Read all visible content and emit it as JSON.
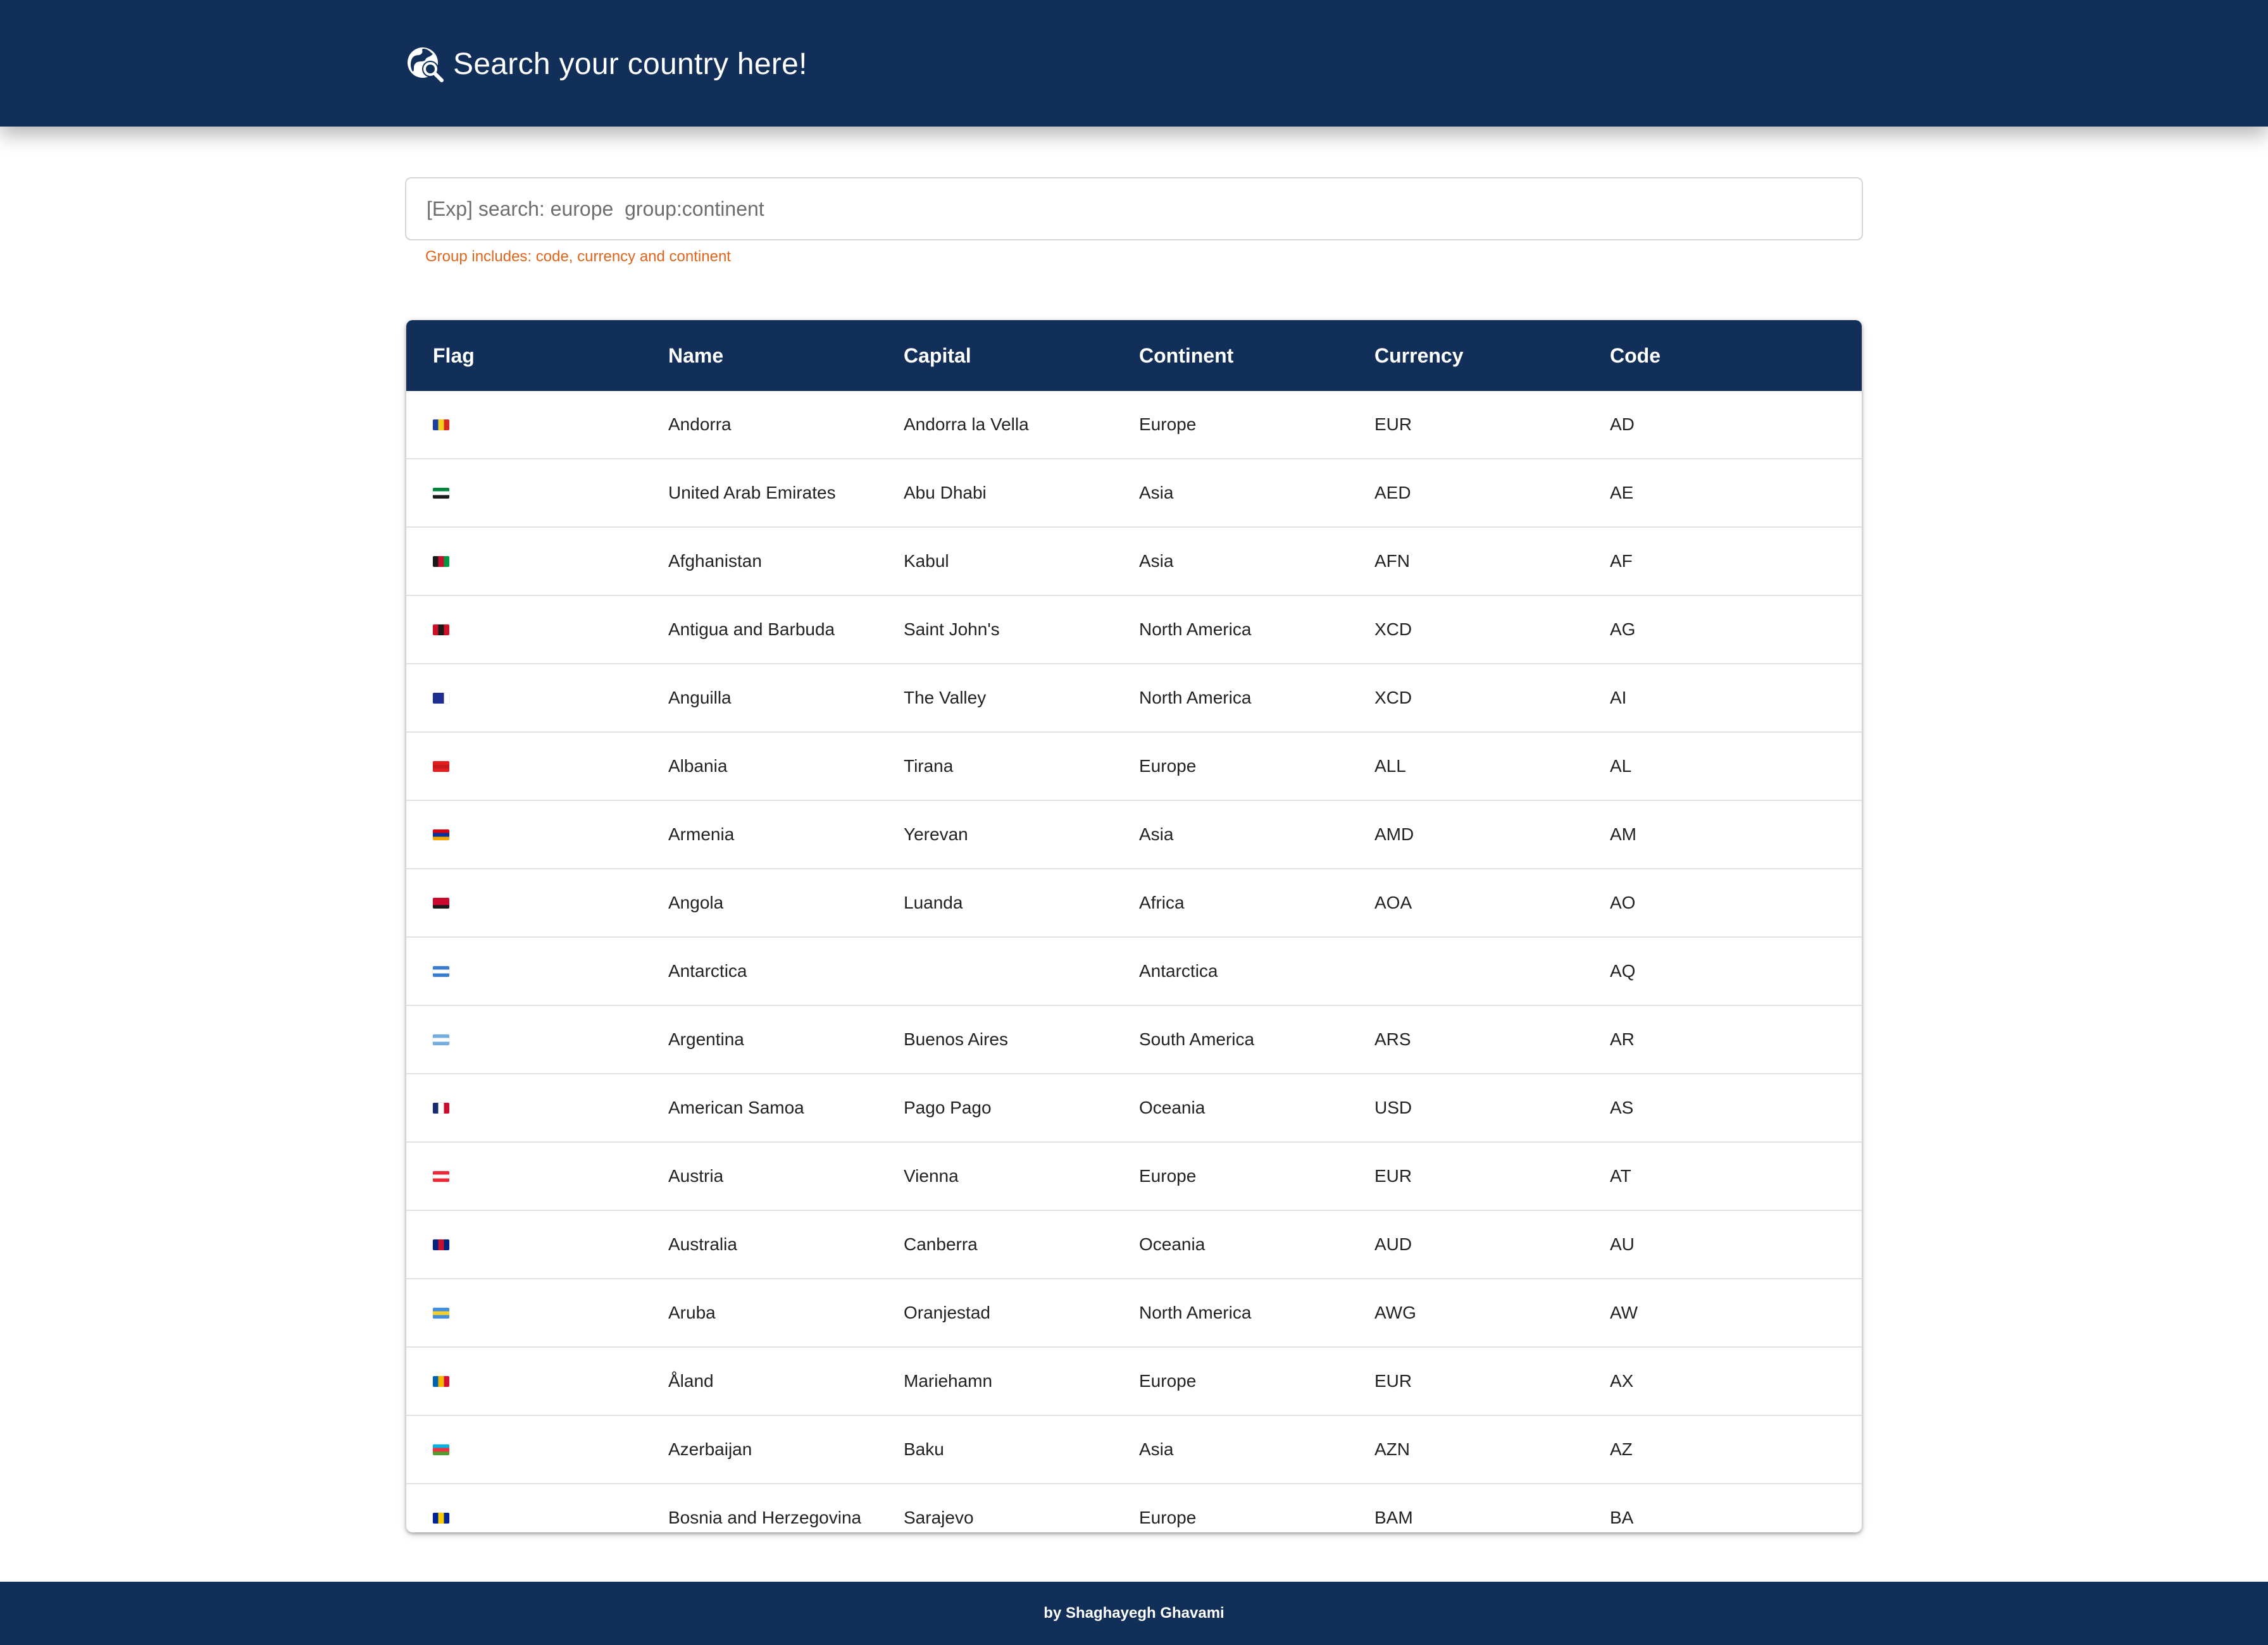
{
  "header": {
    "title": "Search your country here!",
    "icon": "globe-search-icon"
  },
  "search": {
    "placeholder": "[Exp] search: europe  group:continent",
    "value": "",
    "helper": "Group includes: code, currency and continent"
  },
  "table": {
    "columns": [
      "Flag",
      "Name",
      "Capital",
      "Continent",
      "Currency",
      "Code"
    ],
    "rows": [
      {
        "flag": "flag-ad-icon",
        "flag_colors": [
          "#1a3fa0",
          "#f2cf1d",
          "#d52b1e"
        ],
        "flag_dir": "v",
        "name": "Andorra",
        "capital": "Andorra la Vella",
        "continent": "Europe",
        "currency": "EUR",
        "code": "AD"
      },
      {
        "flag": "flag-ae-icon",
        "flag_colors": [
          "#00843d",
          "#ffffff",
          "#1a1a1a"
        ],
        "flag_dir": "h",
        "name": "United Arab Emirates",
        "capital": "Abu Dhabi",
        "continent": "Asia",
        "currency": "AED",
        "code": "AE"
      },
      {
        "flag": "flag-af-icon",
        "flag_colors": [
          "#1a1a1a",
          "#c8102e",
          "#009a44"
        ],
        "flag_dir": "v",
        "name": "Afghanistan",
        "capital": "Kabul",
        "continent": "Asia",
        "currency": "AFN",
        "code": "AF"
      },
      {
        "flag": "flag-ag-icon",
        "flag_colors": [
          "#ce1126",
          "#1a1a1a",
          "#ce1126"
        ],
        "flag_dir": "v",
        "name": "Antigua and Barbuda",
        "capital": "Saint John's",
        "continent": "North America",
        "currency": "XCD",
        "code": "AG"
      },
      {
        "flag": "flag-ai-icon",
        "flag_colors": [
          "#1e2e8f",
          "#1e2e8f",
          "#ffffff"
        ],
        "flag_dir": "v",
        "name": "Anguilla",
        "capital": "The Valley",
        "continent": "North America",
        "currency": "XCD",
        "code": "AI"
      },
      {
        "flag": "flag-al-icon",
        "flag_colors": [
          "#e41e20",
          "#c51a1b",
          "#e41e20"
        ],
        "flag_dir": "h",
        "name": "Albania",
        "capital": "Tirana",
        "continent": "Europe",
        "currency": "ALL",
        "code": "AL"
      },
      {
        "flag": "flag-am-icon",
        "flag_colors": [
          "#d90012",
          "#0033a0",
          "#f2a800"
        ],
        "flag_dir": "h",
        "name": "Armenia",
        "capital": "Yerevan",
        "continent": "Asia",
        "currency": "AMD",
        "code": "AM"
      },
      {
        "flag": "flag-ao-icon",
        "flag_colors": [
          "#cc092f",
          "#cc092f",
          "#1a1a1a"
        ],
        "flag_dir": "h",
        "name": "Angola",
        "capital": "Luanda",
        "continent": "Africa",
        "currency": "AOA",
        "code": "AO"
      },
      {
        "flag": "flag-aq-icon",
        "flag_colors": [
          "#3a7dce",
          "#ffffff",
          "#3a7dce"
        ],
        "flag_dir": "h",
        "name": "Antarctica",
        "capital": "",
        "continent": "Antarctica",
        "currency": "",
        "code": "AQ"
      },
      {
        "flag": "flag-ar-icon",
        "flag_colors": [
          "#74acdf",
          "#ffffff",
          "#74acdf"
        ],
        "flag_dir": "h",
        "name": "Argentina",
        "capital": "Buenos Aires",
        "continent": "South America",
        "currency": "ARS",
        "code": "AR"
      },
      {
        "flag": "flag-as-icon",
        "flag_colors": [
          "#1a2c6b",
          "#ffffff",
          "#c8102e"
        ],
        "flag_dir": "v",
        "name": "American Samoa",
        "capital": "Pago Pago",
        "continent": "Oceania",
        "currency": "USD",
        "code": "AS"
      },
      {
        "flag": "flag-at-icon",
        "flag_colors": [
          "#ed2939",
          "#ffffff",
          "#ed2939"
        ],
        "flag_dir": "h",
        "name": "Austria",
        "capital": "Vienna",
        "continent": "Europe",
        "currency": "EUR",
        "code": "AT"
      },
      {
        "flag": "flag-au-icon",
        "flag_colors": [
          "#00247d",
          "#c8102e",
          "#00247d"
        ],
        "flag_dir": "v",
        "name": "Australia",
        "capital": "Canberra",
        "continent": "Oceania",
        "currency": "AUD",
        "code": "AU"
      },
      {
        "flag": "flag-aw-icon",
        "flag_colors": [
          "#418fde",
          "#f5d130",
          "#418fde"
        ],
        "flag_dir": "h",
        "name": "Aruba",
        "capital": "Oranjestad",
        "continent": "North America",
        "currency": "AWG",
        "code": "AW"
      },
      {
        "flag": "flag-ax-icon",
        "flag_colors": [
          "#0064ae",
          "#f2b700",
          "#d21034"
        ],
        "flag_dir": "v",
        "name": "Åland",
        "capital": "Mariehamn",
        "continent": "Europe",
        "currency": "EUR",
        "code": "AX"
      },
      {
        "flag": "flag-az-icon",
        "flag_colors": [
          "#00b5e2",
          "#ef3340",
          "#509e2f"
        ],
        "flag_dir": "h",
        "name": "Azerbaijan",
        "capital": "Baku",
        "continent": "Asia",
        "currency": "AZN",
        "code": "AZ"
      },
      {
        "flag": "flag-ba-icon",
        "flag_colors": [
          "#002395",
          "#fecb00",
          "#002395"
        ],
        "flag_dir": "v",
        "name": "Bosnia and Herzegovina",
        "capital": "Sarajevo",
        "continent": "Europe",
        "currency": "BAM",
        "code": "BA"
      }
    ]
  },
  "footer": {
    "credit": "by Shaghayegh Ghavami"
  },
  "colors": {
    "brand": "#112f58",
    "helper": "#e0651c"
  }
}
